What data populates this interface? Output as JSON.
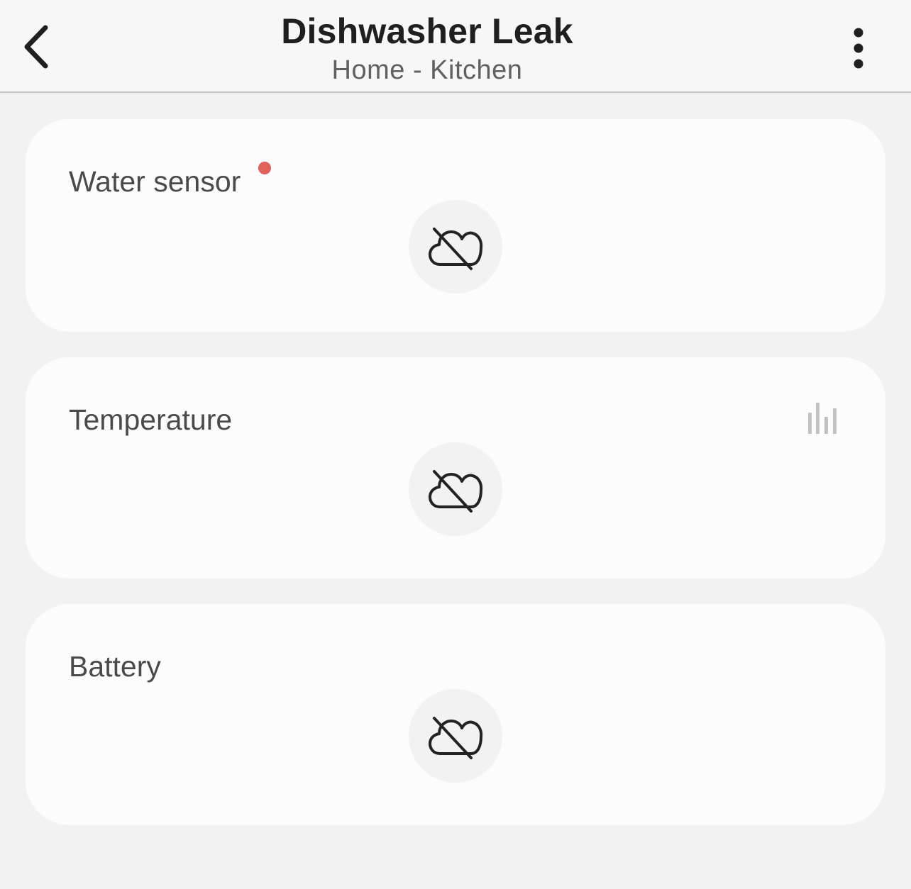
{
  "header": {
    "title": "Dishwasher Leak",
    "subtitle": "Home - Kitchen",
    "back_icon": "chevron-left-icon",
    "more_icon": "more-vertical-icon"
  },
  "cards": [
    {
      "label": "Water sensor",
      "status_icon": "cloud-offline-icon",
      "has_alert_dot": true
    },
    {
      "label": "Temperature",
      "status_icon": "cloud-offline-icon",
      "has_history_icon": true
    },
    {
      "label": "Battery",
      "status_icon": "cloud-offline-icon"
    }
  ],
  "colors": {
    "alert_dot": "#e0605a",
    "background": "#f2f2f2",
    "card": "#fcfcfc"
  }
}
